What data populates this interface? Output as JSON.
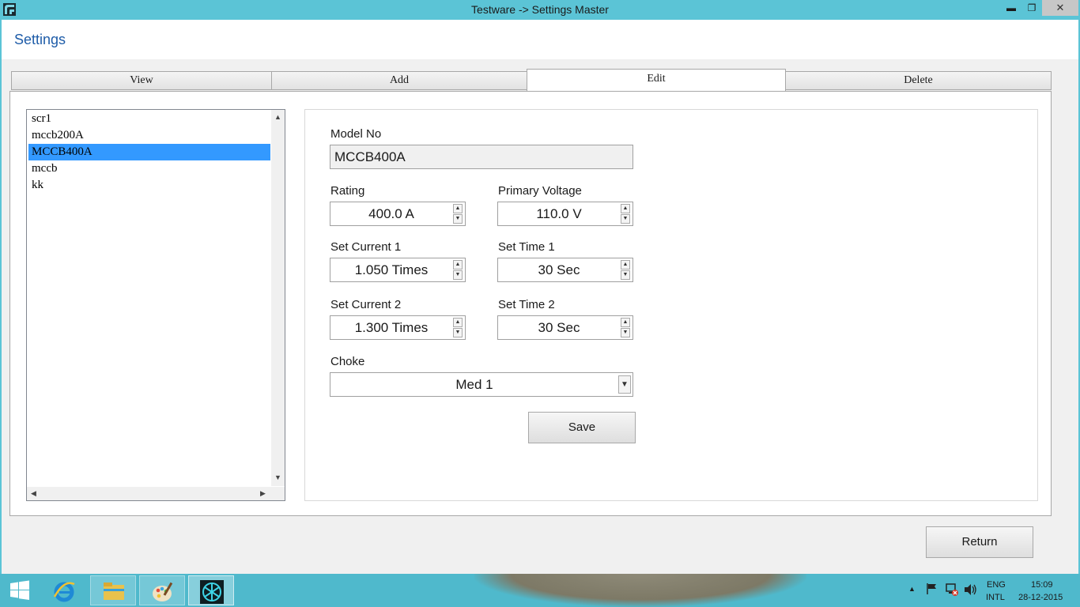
{
  "window": {
    "title": "Testware -> Settings Master",
    "min_glyph": "▬",
    "max_glyph": "❐",
    "close_glyph": "✕"
  },
  "page": {
    "title": "Settings"
  },
  "tabs": [
    {
      "label": "View",
      "active": false
    },
    {
      "label": "Add",
      "active": false
    },
    {
      "label": "Edit",
      "active": true
    },
    {
      "label": "Delete",
      "active": false
    }
  ],
  "model_list": {
    "items": [
      {
        "label": "scr1",
        "selected": false
      },
      {
        "label": "mccb200A",
        "selected": false
      },
      {
        "label": "MCCB400A",
        "selected": true
      },
      {
        "label": "mccb",
        "selected": false
      },
      {
        "label": "kk",
        "selected": false
      }
    ]
  },
  "form": {
    "model_no": {
      "label": "Model No",
      "value": "MCCB400A"
    },
    "rating": {
      "label": "Rating",
      "value": "400.0 A"
    },
    "primary_voltage": {
      "label": "Primary Voltage",
      "value": "110.0 V"
    },
    "set_current_1": {
      "label": "Set Current 1",
      "value": "1.050 Times"
    },
    "set_time_1": {
      "label": "Set Time 1",
      "value": "30 Sec"
    },
    "set_current_2": {
      "label": "Set Current 2",
      "value": "1.300 Times"
    },
    "set_time_2": {
      "label": "Set Time 2",
      "value": "30 Sec"
    },
    "choke": {
      "label": "Choke",
      "value": "Med 1"
    },
    "save_label": "Save"
  },
  "return_label": "Return",
  "taskbar": {
    "apps": [
      "windows-start",
      "internet-explorer",
      "file-explorer",
      "paint",
      "testware"
    ],
    "tray": {
      "lang_top": "ENG",
      "lang_bottom": "INTL",
      "time": "15:09",
      "date": "28-12-2015",
      "chevron": "▲"
    }
  },
  "colors": {
    "accent": "#5bc4d6",
    "title_blue": "#1e5ca8",
    "selection": "#3399ff"
  }
}
